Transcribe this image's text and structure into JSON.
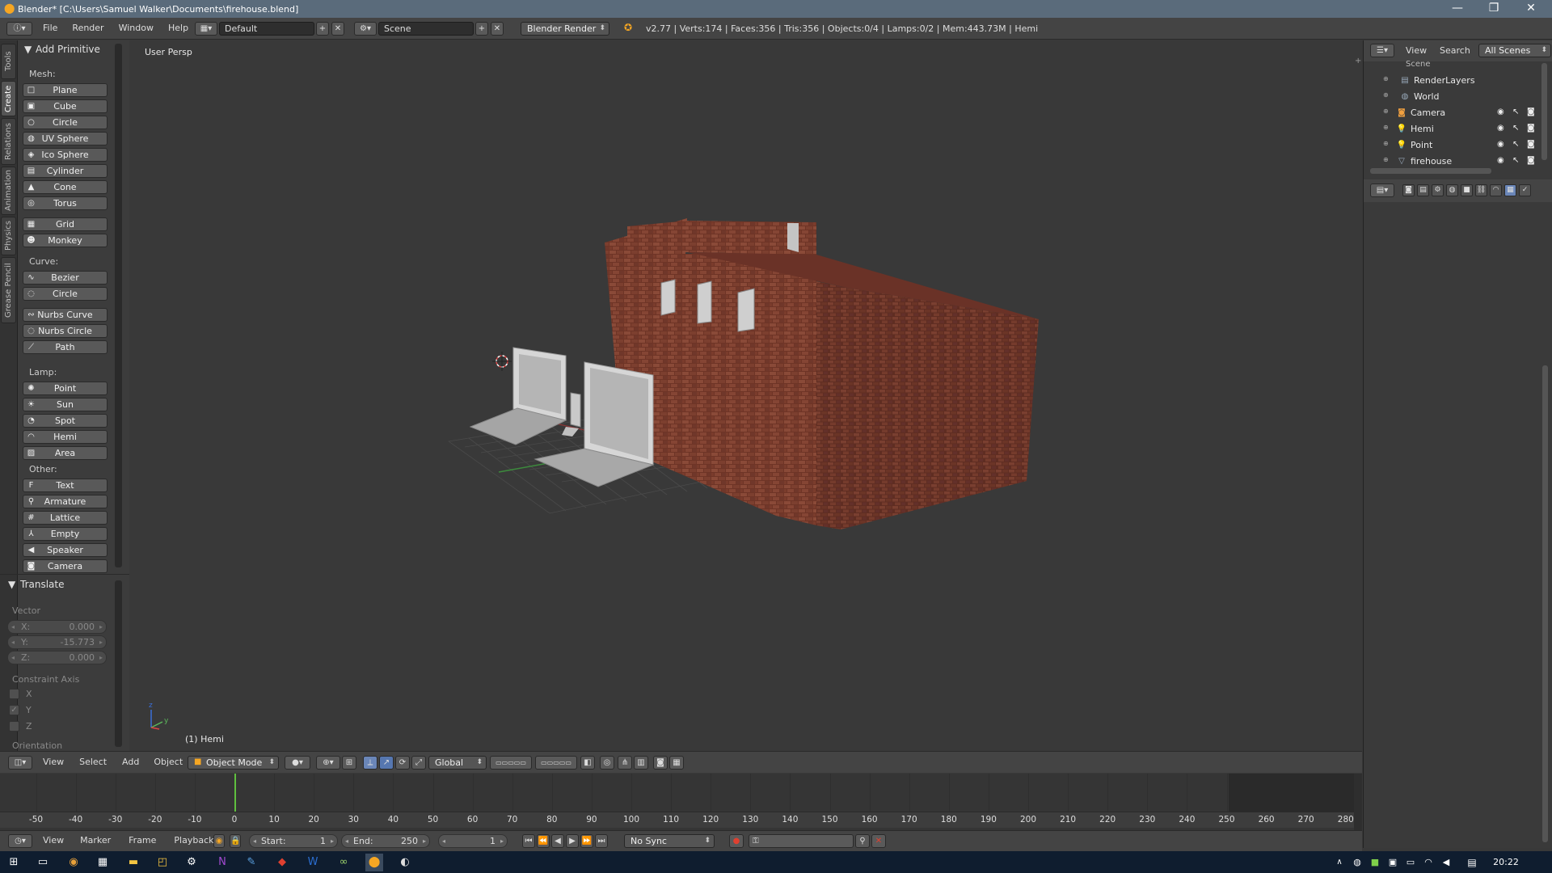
{
  "window": {
    "title": "Blender* [C:\\Users\\Samuel Walker\\Documents\\firehouse.blend]",
    "minimize": "—",
    "restore": "❐",
    "close": "✕"
  },
  "info_header": {
    "menus": [
      "File",
      "Render",
      "Window",
      "Help"
    ],
    "screen_layout": "Default",
    "scene": "Scene",
    "render_engine": "Blender Render",
    "stats": "v2.77 | Verts:174 | Faces:356 | Tris:356 | Objects:0/4 | Lamps:0/2 | Mem:443.73M | Hemi"
  },
  "vertical_tabs": [
    "Tools",
    "Create",
    "Relations",
    "Animation",
    "Physics",
    "Grease Pencil"
  ],
  "tool_shelf": {
    "panel_title": "Add Primitive",
    "mesh": {
      "heading": "Mesh:",
      "items": [
        {
          "label": "Plane",
          "icon": "□"
        },
        {
          "label": "Cube",
          "icon": "▣"
        },
        {
          "label": "Circle",
          "icon": "○"
        },
        {
          "label": "UV Sphere",
          "icon": "◍"
        },
        {
          "label": "Ico Sphere",
          "icon": "◈"
        },
        {
          "label": "Cylinder",
          "icon": "▤"
        },
        {
          "label": "Cone",
          "icon": "▲"
        },
        {
          "label": "Torus",
          "icon": "◎"
        }
      ],
      "items2": [
        {
          "label": "Grid",
          "icon": "▦"
        },
        {
          "label": "Monkey",
          "icon": "☻"
        }
      ]
    },
    "curve": {
      "heading": "Curve:",
      "items": [
        {
          "label": "Bezier",
          "icon": "∿"
        },
        {
          "label": "Circle",
          "icon": "◌"
        }
      ],
      "items2": [
        {
          "label": "Nurbs Curve",
          "icon": "∾"
        },
        {
          "label": "Nurbs Circle",
          "icon": "◌"
        },
        {
          "label": "Path",
          "icon": "⟋"
        }
      ]
    },
    "lamp": {
      "heading": "Lamp:",
      "items": [
        {
          "label": "Point",
          "icon": "✺"
        },
        {
          "label": "Sun",
          "icon": "☀"
        },
        {
          "label": "Spot",
          "icon": "◔"
        },
        {
          "label": "Hemi",
          "icon": "◠"
        },
        {
          "label": "Area",
          "icon": "▨"
        }
      ]
    },
    "other": {
      "heading": "Other:",
      "items": [
        {
          "label": "Text",
          "icon": "F"
        },
        {
          "label": "Armature",
          "icon": "⚲"
        },
        {
          "label": "Lattice",
          "icon": "#"
        },
        {
          "label": "Empty",
          "icon": "⅄"
        },
        {
          "label": "Speaker",
          "icon": "◀"
        },
        {
          "label": "Camera",
          "icon": "◙"
        }
      ]
    },
    "translate": {
      "title": "Translate",
      "vector_label": "Vector",
      "x_label": "X:",
      "x": "0.000",
      "y_label": "Y:",
      "y": "-15.773",
      "z_label": "Z:",
      "z": "0.000",
      "constraint_label": "Constraint Axis",
      "cx": "X",
      "cy": "Y",
      "cz": "Z",
      "cy_checked": true,
      "orientation_label": "Orientation"
    }
  },
  "viewport": {
    "view_label": "User Persp",
    "active_object": "(1) Hemi"
  },
  "header_3d": {
    "menus": [
      "View",
      "Select",
      "Add",
      "Object"
    ],
    "mode": "Object Mode",
    "orientation": "Global"
  },
  "timeline": {
    "ticks": [
      "-50",
      "-40",
      "-30",
      "-20",
      "-10",
      "0",
      "10",
      "20",
      "30",
      "40",
      "50",
      "60",
      "70",
      "80",
      "90",
      "100",
      "110",
      "120",
      "130",
      "140",
      "150",
      "160",
      "170",
      "180",
      "190",
      "200",
      "210",
      "220",
      "230",
      "240",
      "250",
      "260",
      "270",
      "280"
    ],
    "current_frame_marker": 0,
    "menus": [
      "View",
      "Marker",
      "Frame",
      "Playback"
    ],
    "start_label": "Start:",
    "start": "1",
    "end_label": "End:",
    "end": "250",
    "current": "1",
    "sync": "No Sync"
  },
  "outliner": {
    "view": "View",
    "search": "Search",
    "filter": "All Scenes",
    "rows": [
      {
        "label": "RenderLayers",
        "icon": "▤"
      },
      {
        "label": "World",
        "icon": "◍"
      },
      {
        "label": "Camera",
        "icon": "◙"
      },
      {
        "label": "Hemi",
        "icon": "💡"
      },
      {
        "label": "Point",
        "icon": "💡"
      },
      {
        "label": "firehouse",
        "icon": "▽"
      }
    ],
    "scene_row": "Scene"
  },
  "taskbar": {
    "time": "20:22"
  },
  "colors": {
    "brick": "#7a3a2a",
    "concrete": "#a8a8a8",
    "timeline_cursor": "#5fbf3f",
    "taskbar": "#0f1d2f"
  }
}
